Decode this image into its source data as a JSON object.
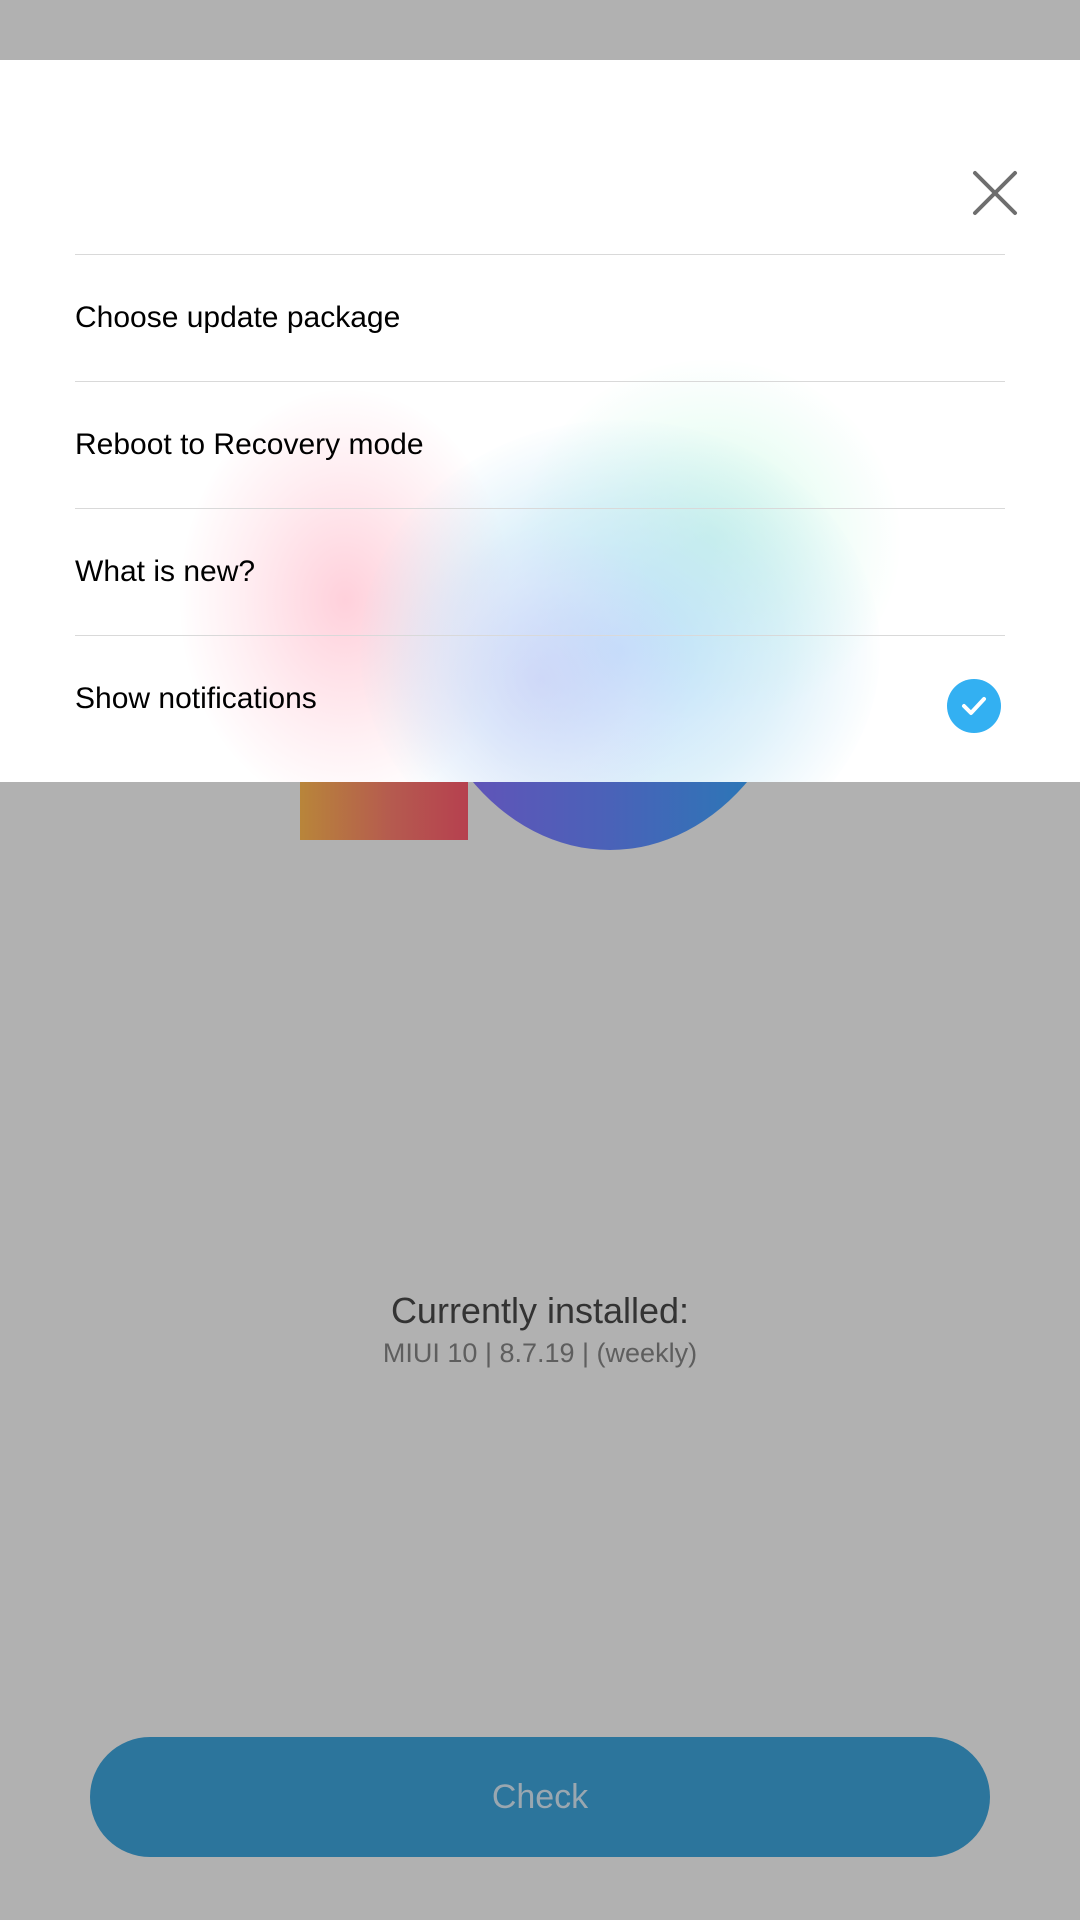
{
  "background": {
    "installed_title": "Currently installed:",
    "installed_version": "MIUI 10 | 8.7.19 | (weekly)",
    "check_label": "Check"
  },
  "menu": {
    "close_icon": "close-icon",
    "items": [
      {
        "label": "Choose update package"
      },
      {
        "label": "Reboot to Recovery mode"
      },
      {
        "label": "What is new?"
      },
      {
        "label": "Show notifications",
        "checked": true
      }
    ]
  },
  "colors": {
    "accent": "#33b0f2",
    "check_button": "#2c759c",
    "scrim": "#b1b1b1"
  }
}
